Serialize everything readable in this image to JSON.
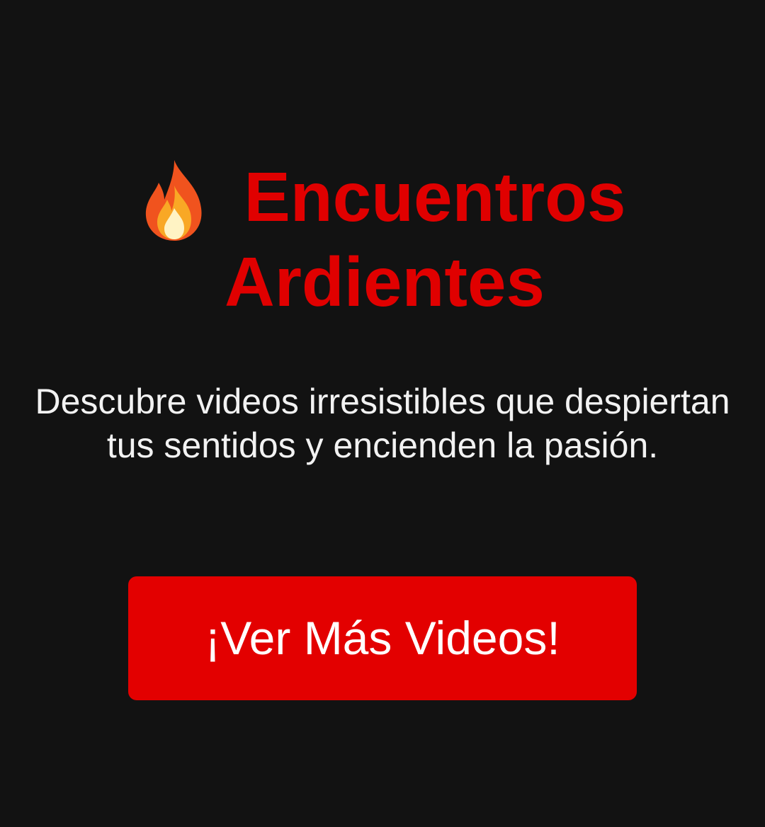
{
  "hero": {
    "icon": "fire-icon",
    "title_line1": "Encuentros",
    "title_line2": "Ardientes",
    "description": "Descubre videos irresistibles que despiertan tus sentidos y encienden la pasión."
  },
  "cta": {
    "label": "¡Ver Más Videos!"
  },
  "colors": {
    "background": "#121212",
    "accent": "#e30000",
    "text": "#f2f2f2"
  }
}
